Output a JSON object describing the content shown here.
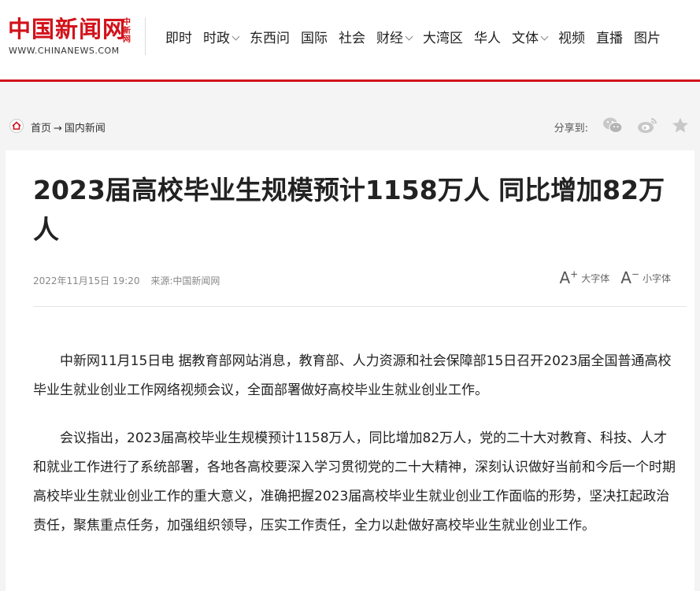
{
  "header": {
    "logo_text": "中国新闻网",
    "logo_side": "中新网",
    "logo_url": "WWW.CHINANEWS.COM",
    "brand_color": "#d2121a",
    "nav": [
      {
        "label": "即时",
        "dropdown": false
      },
      {
        "label": "时政",
        "dropdown": true
      },
      {
        "label": "东西问",
        "dropdown": false
      },
      {
        "label": "国际",
        "dropdown": false
      },
      {
        "label": "社会",
        "dropdown": false
      },
      {
        "label": "财经",
        "dropdown": true
      },
      {
        "label": "大湾区",
        "dropdown": false
      },
      {
        "label": "华人",
        "dropdown": false
      },
      {
        "label": "文体",
        "dropdown": true
      },
      {
        "label": "视频",
        "dropdown": false
      },
      {
        "label": "直播",
        "dropdown": false
      },
      {
        "label": "图片",
        "dropdown": false
      }
    ]
  },
  "breadcrumb": {
    "home": "首页",
    "arrow": "→",
    "current": "国内新闻"
  },
  "share": {
    "label": "分享到:",
    "icons": [
      "wechat-icon",
      "weibo-icon",
      "favorite-star-icon"
    ]
  },
  "article": {
    "title": "2023届高校毕业生规模预计1158万人 同比增加82万人",
    "date": "2022年11月15日 19:20",
    "source": "来源:中国新闻网",
    "font_large_label": "大字体",
    "font_small_label": "小字体",
    "paragraphs": [
      "中新网11月15日电 据教育部网站消息，教育部、人力资源和社会保障部15日召开2023届全国普通高校毕业生就业创业工作网络视频会议，全面部署做好高校毕业生就业创业工作。",
      "会议指出，2023届高校毕业生规模预计1158万人，同比增加82万人，党的二十大对教育、科技、人才和就业工作进行了系统部署，各地各高校要深入学习贯彻党的二十大精神，深刻认识做好当前和今后一个时期高校毕业生就业创业工作的重大意义，准确把握2023届高校毕业生就业创业工作面临的形势，坚决扛起政治责任，聚焦重点任务，加强组织领导，压实工作责任，全力以赴做好高校毕业生就业创业工作。"
    ]
  }
}
